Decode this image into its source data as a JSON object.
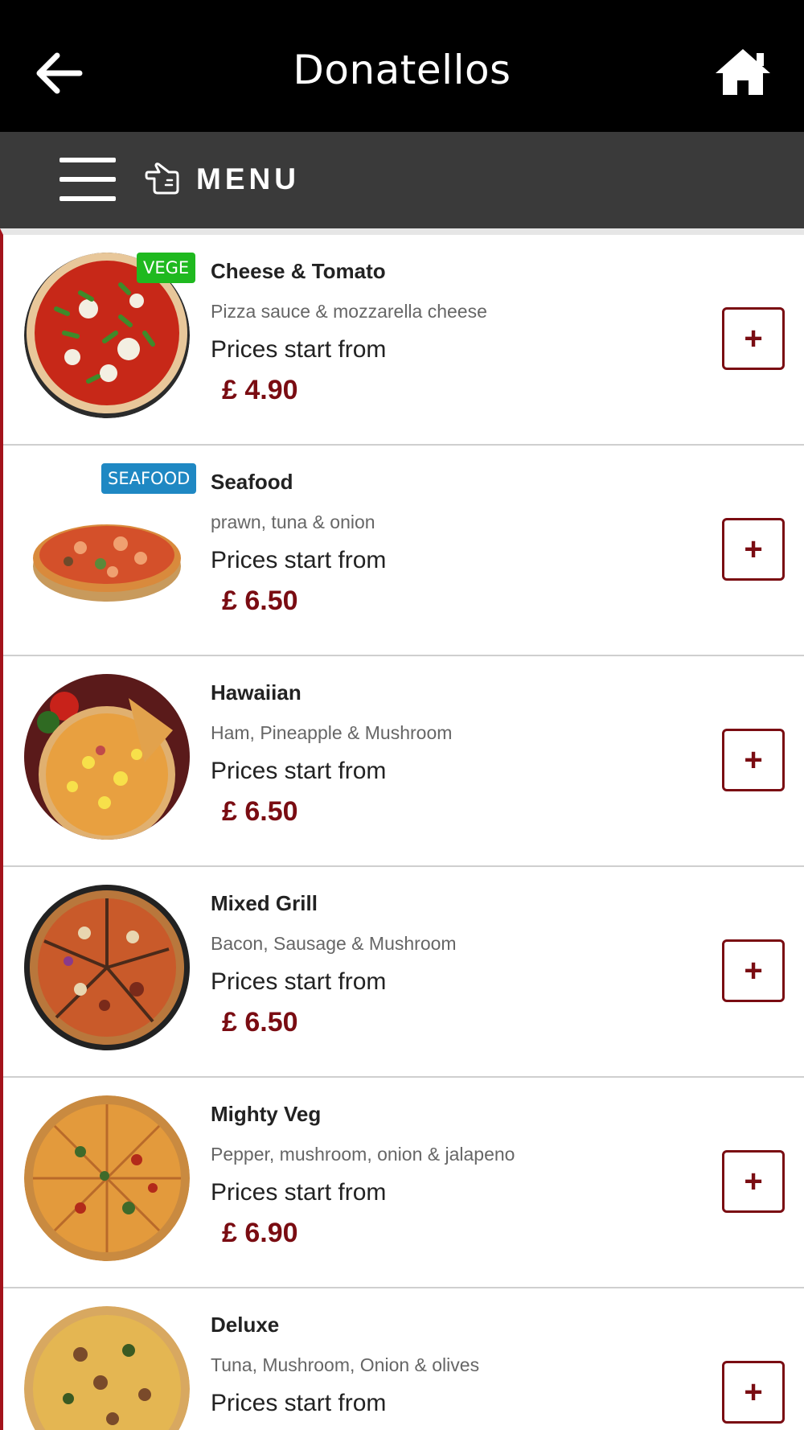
{
  "header": {
    "title": "Donatellos"
  },
  "menubar": {
    "label": "MENU"
  },
  "items": [
    {
      "name": "Cheese & Tomato",
      "description": "Pizza sauce & mozzarella cheese",
      "prices_label": "Prices start from",
      "price": "£ 4.90",
      "badge": "VEGE",
      "add_label": "+"
    },
    {
      "name": "Seafood",
      "description": "prawn, tuna & onion",
      "prices_label": "Prices start from",
      "price": "£ 6.50",
      "badge": "SEAFOOD",
      "add_label": "+"
    },
    {
      "name": "Hawaiian",
      "description": "Ham, Pineapple & Mushroom",
      "prices_label": "Prices start from",
      "price": "£ 6.50",
      "add_label": "+"
    },
    {
      "name": "Mixed Grill",
      "description": "Bacon, Sausage & Mushroom",
      "prices_label": "Prices start from",
      "price": "£ 6.50",
      "add_label": "+"
    },
    {
      "name": "Mighty Veg",
      "description": "Pepper, mushroom, onion & jalapeno",
      "prices_label": "Prices start from",
      "price": "£ 6.90",
      "add_label": "+"
    },
    {
      "name": "Deluxe",
      "description": "Tuna, Mushroom, Onion & olives",
      "prices_label": "Prices start from",
      "price": "",
      "add_label": "+"
    }
  ],
  "colors": {
    "header_bg": "#000000",
    "menubar_bg": "#3a3a3a",
    "accent": "#7a0c12",
    "vege_badge": "#1fb91f",
    "seafood_badge": "#1f88c3"
  },
  "icons": {
    "back": "arrow-left-icon",
    "home": "home-icon",
    "menu": "hamburger-icon",
    "hand": "pointing-hand-icon"
  }
}
